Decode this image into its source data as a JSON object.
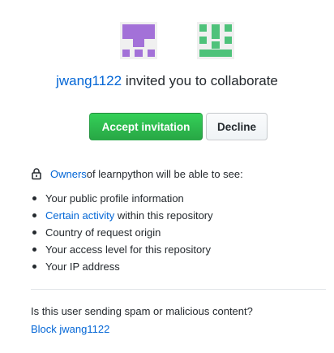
{
  "inviter": {
    "username": "jwang1122",
    "invite_text": " invited you to collaborate"
  },
  "actions": {
    "accept_label": "Accept invitation",
    "decline_label": "Decline"
  },
  "permissions": {
    "owners_label": "Owners",
    "owners_suffix": " of learnpython will be able to see:",
    "items": [
      {
        "link": "",
        "text": "Your public profile information"
      },
      {
        "link": "Certain activity",
        "text": " within this repository"
      },
      {
        "link": "",
        "text": "Country of request origin"
      },
      {
        "link": "",
        "text": "Your access level for this repository"
      },
      {
        "link": "",
        "text": "Your IP address"
      }
    ]
  },
  "report": {
    "question": "Is this user sending spam or malicious content?",
    "block_label": "Block jwang1122"
  },
  "colors": {
    "link": "#0366d6",
    "accept_bg": "#28a745",
    "avatar_left": "#a371d8",
    "avatar_right": "#4ec27a"
  },
  "icons": {
    "owners_line": "lock-icon"
  }
}
